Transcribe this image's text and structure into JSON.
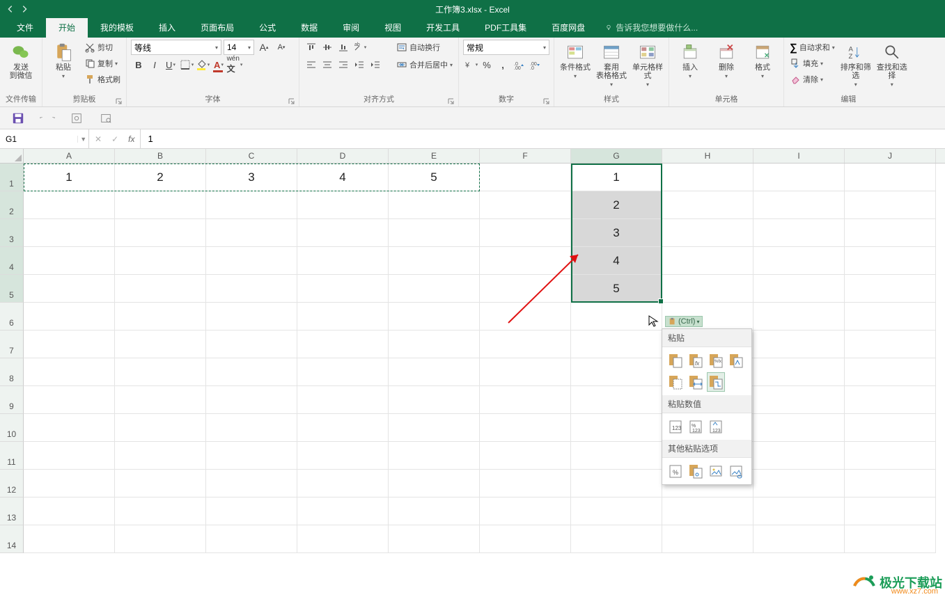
{
  "title": "工作簿3.xlsx - Excel",
  "tabs": [
    "文件",
    "开始",
    "我的模板",
    "插入",
    "页面布局",
    "公式",
    "数据",
    "审阅",
    "视图",
    "开发工具",
    "PDF工具集",
    "百度网盘"
  ],
  "active_tab": 1,
  "tell_me": "告诉我您想要做什么...",
  "groups": {
    "wechat": {
      "line1": "发送",
      "line2": "到微信",
      "label": "文件传输"
    },
    "clipboard": {
      "paste": "粘贴",
      "cut": "剪切",
      "copy": "复制",
      "painter": "格式刷",
      "label": "剪贴板"
    },
    "font": {
      "name": "等线",
      "size": "14",
      "label": "字体"
    },
    "align": {
      "wrap": "自动换行",
      "merge": "合并后居中",
      "label": "对齐方式"
    },
    "number": {
      "format": "常规",
      "label": "数字"
    },
    "styles": {
      "cond": "条件格式",
      "table": "套用\n表格格式",
      "cell": "单元格样式",
      "label": "样式"
    },
    "cells": {
      "insert": "插入",
      "delete": "删除",
      "format": "格式",
      "label": "单元格"
    },
    "editing": {
      "sum": "自动求和",
      "fill": "填充",
      "clear": "清除",
      "sort": "排序和筛选",
      "find": "查找和选择",
      "label": "编辑"
    }
  },
  "namebox": "G1",
  "formula": "1",
  "columns": [
    "A",
    "B",
    "C",
    "D",
    "E",
    "F",
    "G",
    "H",
    "I",
    "J"
  ],
  "rows": [
    1,
    2,
    3,
    4,
    5,
    6,
    7,
    8,
    9,
    10,
    11,
    12,
    13,
    14
  ],
  "source_cells": {
    "row": 1,
    "values": [
      "1",
      "2",
      "3",
      "4",
      "5"
    ],
    "cols": [
      "A",
      "B",
      "C",
      "D",
      "E"
    ]
  },
  "dest_cells": {
    "col": "G",
    "start_row": 1,
    "values": [
      "1",
      "2",
      "3",
      "4",
      "5"
    ]
  },
  "paste_ctrl_label": "(Ctrl)",
  "paste_menu": {
    "sect1": "粘贴",
    "sect2": "粘贴数值",
    "sect3": "其他粘贴选项"
  },
  "watermark": {
    "text": "极光下载站",
    "url": "www.xz7.com"
  }
}
